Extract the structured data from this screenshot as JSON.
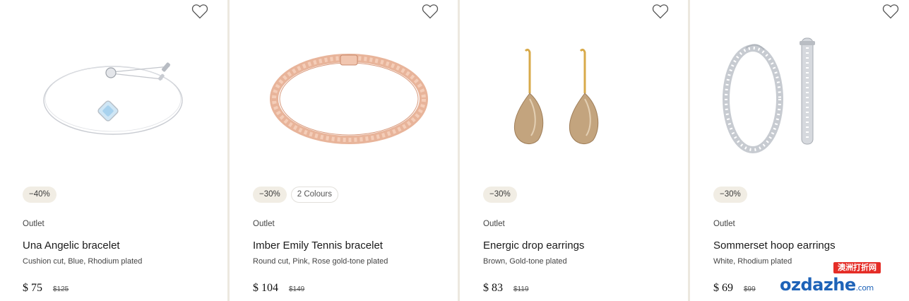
{
  "products": [
    {
      "discount": "−40%",
      "colours": "",
      "label": "Outlet",
      "name": "Una Angelic bracelet",
      "description": "Cushion cut, Blue, Rhodium plated",
      "price": "$ 75",
      "old_price": "$125",
      "image_icon": "bracelet-chain-blue-stone"
    },
    {
      "discount": "−30%",
      "colours": "2 Colours",
      "label": "Outlet",
      "name": "Imber Emily Tennis bracelet",
      "description": "Round cut, Pink, Rose gold-tone plated",
      "price": "$ 104",
      "old_price": "$149",
      "image_icon": "tennis-bracelet-rose-gold"
    },
    {
      "discount": "−30%",
      "colours": "",
      "label": "Outlet",
      "name": "Energic drop earrings",
      "description": "Brown, Gold-tone plated",
      "price": "$ 83",
      "old_price": "$119",
      "image_icon": "drop-earrings-brown"
    },
    {
      "discount": "−30%",
      "colours": "",
      "label": "Outlet",
      "name": "Sommerset hoop earrings",
      "description": "White, Rhodium plated",
      "price": "$ 69",
      "old_price": "$99",
      "image_icon": "hoop-earrings-silver"
    }
  ],
  "wishlist_icon": "heart-outline-icon",
  "watermark": {
    "top_text": "澳洲打折网",
    "main_text": "ozdazhe",
    "suffix": ".com"
  },
  "colors": {
    "divider": "#ece8df",
    "discount_badge_bg": "#f1ede4",
    "watermark_red": "#e52d27",
    "watermark_blue": "#1e63b8"
  }
}
